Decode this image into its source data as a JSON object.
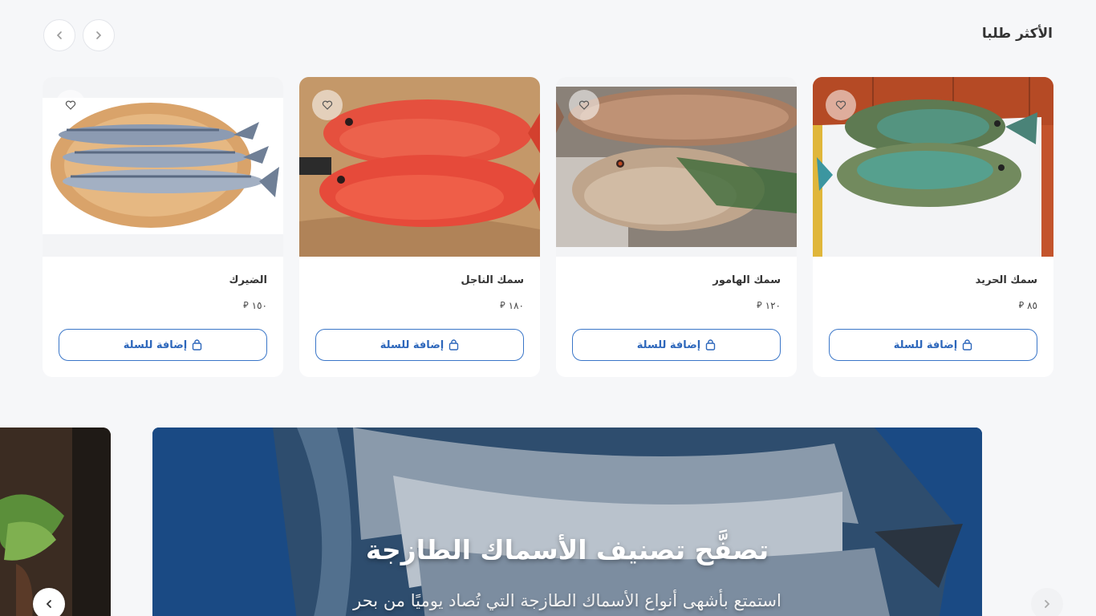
{
  "section": {
    "title": "الأكثر طلبا"
  },
  "carousel_nav": {
    "prev_icon": "chevron-left-icon",
    "next_icon": "chevron-right-icon"
  },
  "products": [
    {
      "name": "سمك الحريد",
      "price": "٨٥",
      "currency_symbol": "⃁",
      "button_label": "إضافة للسلة",
      "image": "parrotfish"
    },
    {
      "name": "سمك الهامور",
      "price": "١٢٠",
      "currency_symbol": "⃁",
      "button_label": "إضافة للسلة",
      "image": "grouper"
    },
    {
      "name": "سمك الناجل",
      "price": "١٨٠",
      "currency_symbol": "⃁",
      "button_label": "إضافة للسلة",
      "image": "coral-grouper"
    },
    {
      "name": "الضيرك",
      "price": "١٥٠",
      "currency_symbol": "⃁",
      "button_label": "إضافة للسلة",
      "image": "kingfish"
    }
  ],
  "banner": {
    "title": "تصفَّح تصنيف الأسماك الطازجة",
    "subtitle": "استمتع بأشهى أنواع الأسماك الطازجة التي تُصاد يوميًا من بحر"
  },
  "colors": {
    "accent": "#2d67bb",
    "background": "#f6f7f9",
    "banner": "#16447c"
  }
}
